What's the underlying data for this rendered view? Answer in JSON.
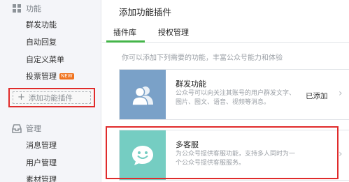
{
  "sidebar": {
    "sections": [
      {
        "icon": "grid-icon",
        "title": "功能",
        "items": [
          {
            "label": "群发功能"
          },
          {
            "label": "自动回复"
          },
          {
            "label": "自定义菜单"
          },
          {
            "label": "投票管理",
            "badge": "NEW"
          }
        ]
      },
      {
        "icon": "tray-icon",
        "title": "管理",
        "items": [
          {
            "label": "消息管理"
          },
          {
            "label": "用户管理"
          },
          {
            "label": "素材管理"
          }
        ]
      }
    ],
    "add_plugin_label": "添加功能插件"
  },
  "main": {
    "title": "添加功能插件",
    "tabs": [
      {
        "label": "插件库",
        "active": true
      },
      {
        "label": "授权管理",
        "active": false
      }
    ],
    "hint": "你可以添加下列需要的功能，丰富公众号能力和体验",
    "plugins": [
      {
        "name": "群发功能",
        "desc": "公众号可以向关注其账号的用户群发文字、图片、图文、语音、视频等消息。",
        "state": "已添加",
        "icon": "users-icon",
        "color": "#7aa1c8"
      },
      {
        "name": "多客服",
        "desc": "为公众号提供客服功能，支持多人同时为一个公众号提供客服服务。",
        "state": "",
        "icon": "smiley-chat-icon",
        "color": "#75cdc2"
      }
    ]
  },
  "colors": {
    "accent": "#44b549",
    "highlight_border": "#e02b2b",
    "badge": "#f0731f"
  }
}
